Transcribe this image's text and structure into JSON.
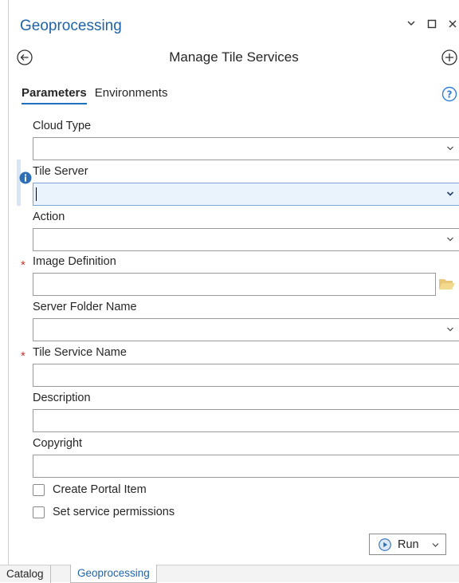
{
  "pane": {
    "title": "Geoprocessing",
    "tool_title": "Manage Tile Services"
  },
  "tabs": [
    {
      "label": "Parameters",
      "active": true
    },
    {
      "label": "Environments",
      "active": false
    }
  ],
  "fields": {
    "cloud_type": {
      "label": "Cloud Type",
      "value": "",
      "required": false,
      "kind": "dropdown"
    },
    "tile_server": {
      "label": "Tile Server",
      "value": "",
      "required": false,
      "kind": "dropdown",
      "focused": true
    },
    "action": {
      "label": "Action",
      "value": "",
      "required": false,
      "kind": "dropdown"
    },
    "image_definition": {
      "label": "Image Definition",
      "value": "",
      "required": true,
      "kind": "file"
    },
    "server_folder_name": {
      "label": "Server Folder Name",
      "value": "",
      "required": false,
      "kind": "dropdown"
    },
    "tile_service_name": {
      "label": "Tile Service Name",
      "value": "",
      "required": true,
      "kind": "text"
    },
    "description": {
      "label": "Description",
      "value": "",
      "required": false,
      "kind": "text"
    },
    "copyright": {
      "label": "Copyright",
      "value": "",
      "required": false,
      "kind": "text"
    }
  },
  "required_marker": "*",
  "checkboxes": [
    {
      "label": "Create Portal Item",
      "checked": false
    },
    {
      "label": "Set service permissions",
      "checked": false
    }
  ],
  "run_button": {
    "label": "Run"
  },
  "bottom_tabs": [
    {
      "label": "Catalog",
      "active": false
    },
    {
      "label": "Geoprocessing",
      "active": true
    }
  ],
  "colors": {
    "accent": "#1f63a8",
    "required": "#c0392b",
    "focus_bg": "#eaf3fc",
    "info": "#2f6fb5"
  }
}
